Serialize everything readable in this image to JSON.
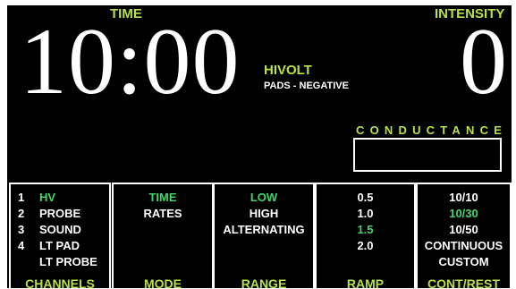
{
  "header": {
    "time_label": "TIME",
    "time_value": "10:00",
    "intensity_label": "INTENSITY",
    "intensity_value": "0",
    "mode_name": "HIVOLT",
    "mode_sub": "PADS - NEGATIVE",
    "conductance_label": "CONDUCTANCE",
    "conductance_value": ""
  },
  "colors": {
    "background": "#000000",
    "label": "#b8e04a",
    "selected": "#41d66a",
    "text": "#ffffff"
  },
  "panels": {
    "channels": {
      "title": "CHANNELS",
      "items": [
        {
          "num": "1",
          "label": "HV",
          "selected": true
        },
        {
          "num": "2",
          "label": "PROBE",
          "selected": false
        },
        {
          "num": "3",
          "label": "SOUND",
          "selected": false
        },
        {
          "num": "4",
          "label": "LT PAD",
          "selected": false
        },
        {
          "num": "",
          "label": "LT PROBE",
          "selected": false
        }
      ]
    },
    "mode": {
      "title": "MODE",
      "items": [
        {
          "label": "TIME",
          "selected": true
        },
        {
          "label": "RATES",
          "selected": false
        }
      ]
    },
    "range": {
      "title": "RANGE",
      "items": [
        {
          "label": "LOW",
          "selected": true
        },
        {
          "label": "HIGH",
          "selected": false
        },
        {
          "label": "ALTERNATING",
          "selected": false
        }
      ]
    },
    "ramp": {
      "title": "RAMP",
      "items": [
        {
          "label": "0.5",
          "selected": false
        },
        {
          "label": "1.0",
          "selected": false
        },
        {
          "label": "1.5",
          "selected": true
        },
        {
          "label": "2.0",
          "selected": false
        }
      ]
    },
    "contrest": {
      "title": "CONT/REST",
      "items": [
        {
          "label": "10/10",
          "selected": false
        },
        {
          "label": "10/30",
          "selected": true
        },
        {
          "label": "10/50",
          "selected": false
        },
        {
          "label": "CONTINUOUS",
          "selected": false
        },
        {
          "label": "CUSTOM",
          "selected": false
        }
      ]
    }
  }
}
